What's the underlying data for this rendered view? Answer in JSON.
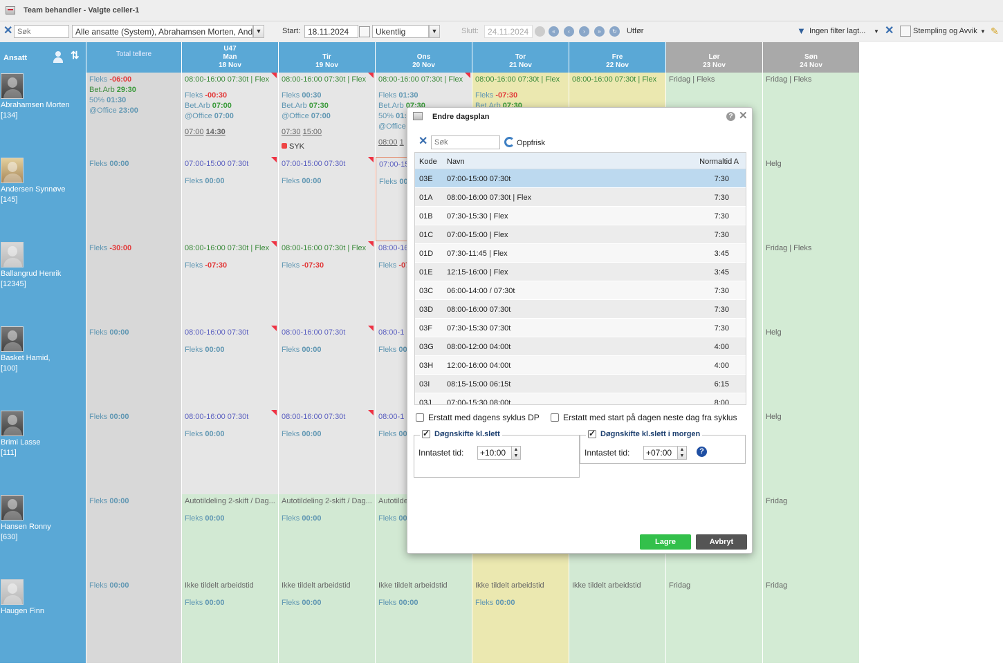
{
  "window": {
    "title": "Team behandler - Valgte celler-1"
  },
  "toolbar": {
    "search_placeholder": "Søk",
    "employees_select": "Alle ansatte (System), Abrahamsen Morten, And",
    "start_label": "Start:",
    "start_date": "18.11.2024",
    "period_select": "Ukentlig",
    "end_label": "Slutt:",
    "end_date": "24.11.2024",
    "execute_label": "Utfør",
    "filter_label": "Ingen filter lagt...",
    "stamping_label": "Stempling og Avvik"
  },
  "grid": {
    "header_ansatt": "Ansatt",
    "header_total": "Total tellere",
    "days": [
      {
        "week": "U47",
        "day": "Man",
        "date": "18 Nov",
        "weekend": false
      },
      {
        "week": "",
        "day": "Tir",
        "date": "19 Nov",
        "weekend": false
      },
      {
        "week": "",
        "day": "Ons",
        "date": "20 Nov",
        "weekend": false
      },
      {
        "week": "",
        "day": "Tor",
        "date": "21 Nov",
        "weekend": false
      },
      {
        "week": "",
        "day": "Fre",
        "date": "22 Nov",
        "weekend": false
      },
      {
        "week": "",
        "day": "Lør",
        "date": "23 Nov",
        "weekend": true
      },
      {
        "week": "",
        "day": "Søn",
        "date": "24 Nov",
        "weekend": true
      }
    ],
    "employees": [
      {
        "name": "Abrahamsen Morten",
        "id": "[134]",
        "totals": [
          {
            "label": "Fleks",
            "value": "-06:00",
            "style": "red"
          },
          {
            "label": "Bet.Arb",
            "value": "29:30",
            "style": "green"
          },
          {
            "label": "50%",
            "value": "01:30",
            "style": "teal"
          },
          {
            "label": "@Office",
            "value": "23:00",
            "style": "teal"
          }
        ],
        "days": {
          "mon": {
            "shift": "08:00-16:00 07:30t | Flex",
            "fleks": "-00:30",
            "betarb": "07:00",
            "office": "07:00",
            "time_a": "07:00",
            "time_b": "14:30"
          },
          "tue": {
            "shift": "08:00-16:00 07:30t | Flex",
            "fleks": "00:30",
            "betarb": "07:30",
            "office": "07:00",
            "time_a": "07:30",
            "time_b": "15:00",
            "syk": "SYK"
          },
          "wed": {
            "shift": "08:00-16:00 07:30t | Flex",
            "fleks": "01:30",
            "betarb": "07:30",
            "pct": "01:3",
            "office": "0",
            "time_a": "08:00",
            "time_b": "1"
          },
          "thu": {
            "shift": "08:00-16:00 07:30t | Flex",
            "fleks": "-07:30",
            "betarb": "07:30"
          },
          "fri": {
            "shift": "08:00-16:00 07:30t | Flex"
          },
          "sat": {
            "shift": "Fridag | Fleks"
          },
          "sun": {
            "shift": "Fridag | Fleks"
          }
        }
      },
      {
        "name": "Andersen Synnøve",
        "id": "[145]",
        "totals": [
          {
            "label": "Fleks",
            "value": "00:00",
            "style": "teal"
          }
        ],
        "days": {
          "mon": {
            "shift": "07:00-15:00 07:30t",
            "fleks": "00:00"
          },
          "tue": {
            "shift": "07:00-15:00 07:30t",
            "fleks": "00:00"
          },
          "wed": {
            "shift": "07:00-15",
            "fleks": "00"
          },
          "sun": {
            "shift": "Helg"
          }
        }
      },
      {
        "name": "Ballangrud Henrik",
        "id": "[12345]",
        "totals": [
          {
            "label": "Fleks",
            "value": "-30:00",
            "style": "red"
          }
        ],
        "days": {
          "mon": {
            "shift": "08:00-16:00 07:30t | Flex",
            "fleks": "-07:30"
          },
          "tue": {
            "shift": "08:00-16:00 07:30t | Flex",
            "fleks": "-07:30"
          },
          "wed": {
            "shift": "08:00-16",
            "fleks": "-07"
          },
          "sun": {
            "shift": "Fridag | Fleks"
          }
        }
      },
      {
        "name": "Basket Hamid,",
        "id": "[100]",
        "totals": [
          {
            "label": "Fleks",
            "value": "00:00",
            "style": "teal"
          }
        ],
        "days": {
          "mon": {
            "shift": "08:00-16:00 07:30t",
            "fleks": "00:00"
          },
          "tue": {
            "shift": "08:00-16:00 07:30t",
            "fleks": "00:00"
          },
          "wed": {
            "shift": "08:00-1",
            "fleks": "00"
          },
          "sun": {
            "shift": "Helg"
          }
        }
      },
      {
        "name": "Brimi Lasse",
        "id": "[111]",
        "totals": [
          {
            "label": "Fleks",
            "value": "00:00",
            "style": "teal"
          }
        ],
        "days": {
          "mon": {
            "shift": "08:00-16:00 07:30t",
            "fleks": "00:00"
          },
          "tue": {
            "shift": "08:00-16:00 07:30t",
            "fleks": "00:00"
          },
          "wed": {
            "shift": "08:00-1",
            "fleks": "00"
          },
          "sun": {
            "shift": "Helg"
          }
        }
      },
      {
        "name": "Hansen Ronny",
        "id": "[630]",
        "totals": [
          {
            "label": "Fleks",
            "value": "00:00",
            "style": "teal"
          }
        ],
        "days": {
          "mon": {
            "shift": "Autotildeling 2-skift / Dag...",
            "fleks": "00:00"
          },
          "tue": {
            "shift": "Autotildeling 2-skift / Dag...",
            "fleks": "00:00"
          },
          "wed": {
            "shift": "Autotilde",
            "fleks": "00"
          },
          "sun": {
            "shift": "Fridag"
          }
        }
      },
      {
        "name": "Haugen Finn",
        "id": "",
        "totals": [
          {
            "label": "Fleks",
            "value": "00:00",
            "style": "teal"
          }
        ],
        "days": {
          "mon": {
            "shift": "Ikke tildelt arbeidstid",
            "fleks": "00:00"
          },
          "tue": {
            "shift": "Ikke tildelt arbeidstid",
            "fleks": "00:00"
          },
          "wed": {
            "shift": "Ikke tildelt arbeidstid",
            "fleks": "00:00"
          },
          "thu": {
            "shift": "Ikke tildelt arbeidstid",
            "fleks": "00:00"
          },
          "fri": {
            "shift": "Ikke tildelt arbeidstid"
          },
          "sat": {
            "shift": "Fridag"
          },
          "sun": {
            "shift": "Fridag"
          }
        }
      }
    ],
    "labels": {
      "fleks": "Fleks",
      "betarb": "Bet.Arb",
      "pct": "50%",
      "office": "@Office"
    }
  },
  "modal": {
    "title": "Endre dagsplan",
    "search_placeholder": "Søk",
    "refresh_label": "Oppfrisk",
    "columns": {
      "kode": "Kode",
      "navn": "Navn",
      "normaltid": "Normaltid A"
    },
    "rows": [
      {
        "kode": "03E",
        "navn": "07:00-15:00 07:30t",
        "norm": "7:30",
        "selected": true
      },
      {
        "kode": "01A",
        "navn": "08:00-16:00 07:30t | Flex",
        "norm": "7:30"
      },
      {
        "kode": "01B",
        "navn": "07:30-15:30 | Flex",
        "norm": "7:30"
      },
      {
        "kode": "01C",
        "navn": "07:00-15:00 | Flex",
        "norm": "7:30"
      },
      {
        "kode": "01D",
        "navn": "07:30-11:45 | Flex",
        "norm": "3:45"
      },
      {
        "kode": "01E",
        "navn": "12:15-16:00 | Flex",
        "norm": "3:45"
      },
      {
        "kode": "03C",
        "navn": "06:00-14:00 / 07:30t",
        "norm": "7:30"
      },
      {
        "kode": "03D",
        "navn": "08:00-16:00 07:30t",
        "norm": "7:30"
      },
      {
        "kode": "03F",
        "navn": "07:30-15:30 07:30t",
        "norm": "7:30"
      },
      {
        "kode": "03G",
        "navn": "08:00-12:00 04:00t",
        "norm": "4:00"
      },
      {
        "kode": "03H",
        "navn": "12:00-16:00 04:00t",
        "norm": "4:00"
      },
      {
        "kode": "03I",
        "navn": "08:15-15:00 06:15t",
        "norm": "6:15"
      },
      {
        "kode": "03J",
        "navn": "07:00-15:30 08:00t",
        "norm": "8:00"
      }
    ],
    "replace_cycle_label": "Erstatt med dagens syklus DP",
    "replace_next_label": "Erstatt med start på dagen neste dag fra syklus",
    "shift_today_label": "Døgnskifte kl.slett",
    "shift_tomorrow_label": "Døgnskifte kl.slett i morgen",
    "entered_time_label": "Inntastet tid:",
    "entered_time_today": "+10:00",
    "entered_time_tomorrow": "+07:00",
    "save_label": "Lagre",
    "cancel_label": "Avbryt"
  }
}
